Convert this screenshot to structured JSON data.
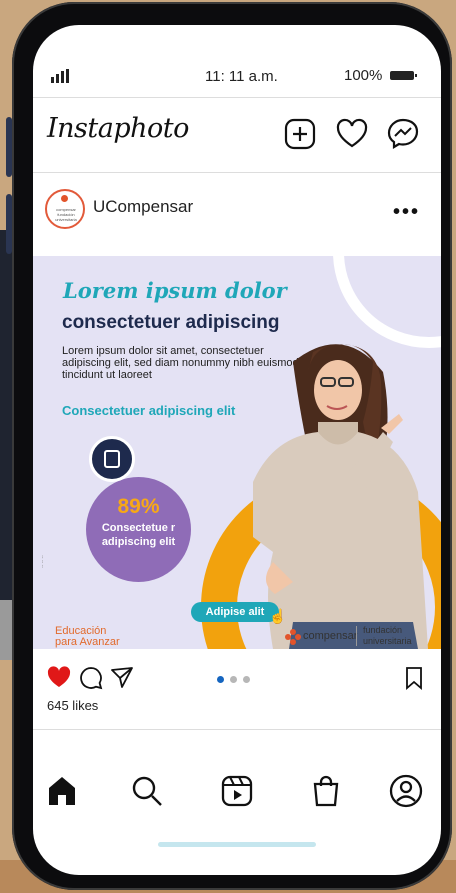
{
  "status_bar": {
    "time": "11: 11 a.m.",
    "battery": "100%"
  },
  "header": {
    "logo": "Instaphoto",
    "icons": [
      "plus-square-icon",
      "heart-icon",
      "messenger-icon"
    ]
  },
  "post": {
    "username": "UCompensar",
    "avatar_text": "compensar fundación universitaria",
    "image": {
      "script_title": "Lorem ipsum dolor",
      "headline": "consectetuer adipiscing",
      "body": "Lorem ipsum dolor sit amet, consectetuer adipiscing elit, sed diam nonummy nibh euismod tincidunt ut laoreet",
      "subhead": "Consectetuer adipiscing elit",
      "stat_value": "89%",
      "stat_caption": "Consectetue r adipiscing elit",
      "cta": "Adipise alit",
      "footer_left_line1": "Educación",
      "footer_left_line2": "para Avanzar",
      "footer_brand": "compensar",
      "footer_right_line1": "fundación",
      "footer_right_line2": "universitaria",
      "colors": {
        "accent": "#1fa7b8",
        "navy": "#1e2a4d",
        "orange": "#f2a20d",
        "purple": "#8f6cb7",
        "bg": "#e4e2f4"
      }
    },
    "likes": "645 likes",
    "carousel": {
      "count": 3,
      "active": 1
    }
  },
  "nav": [
    "home-icon",
    "search-icon",
    "reels-icon",
    "shop-icon",
    "profile-icon"
  ]
}
